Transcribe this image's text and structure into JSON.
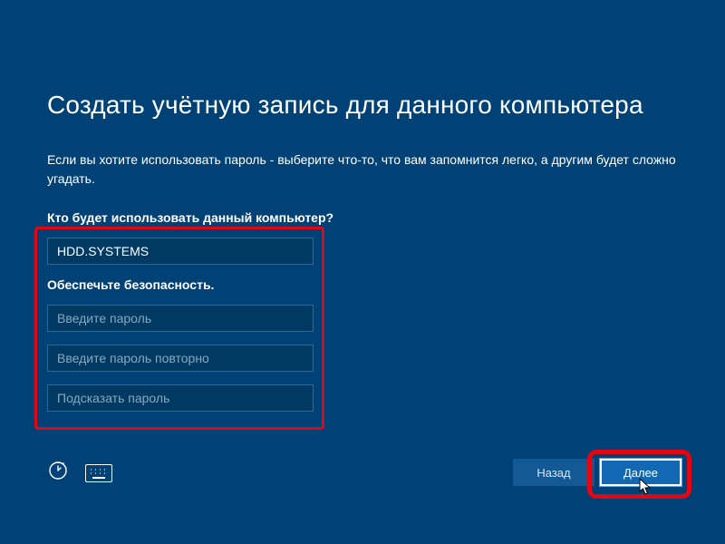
{
  "title": "Создать учётную запись для данного компьютера",
  "subtitle": "Если вы хотите использовать пароль - выберите что-то, что вам запомнится легко, а другим будет сложно угадать.",
  "section_user": "Кто будет использовать данный компьютер?",
  "username_value": "HDD.SYSTEMS",
  "section_security": "Обеспечьте безопасность.",
  "pwd_placeholder": "Введите пароль",
  "pwd2_placeholder": "Введите пароль повторно",
  "hint_placeholder": "Подсказать пароль",
  "buttons": {
    "back": "Назад",
    "next": "Далее"
  }
}
